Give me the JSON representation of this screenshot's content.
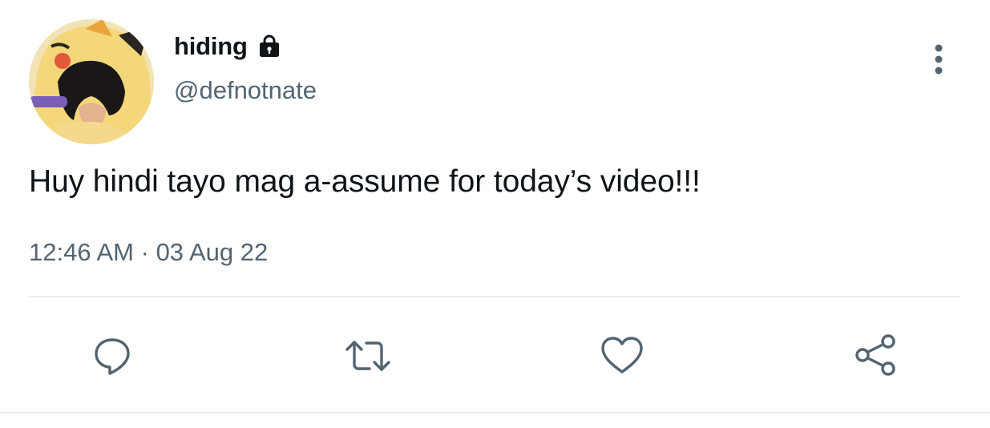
{
  "user": {
    "display_name": "hiding",
    "handle": "@defnotnate",
    "protected_icon": "lock-icon"
  },
  "tweet": {
    "text": "Huy hindi tayo mag a-assume for today’s video!!!",
    "time": "12:46 AM",
    "separator": "·",
    "date": "03 Aug 22"
  },
  "actions": [
    {
      "name": "reply",
      "icon": "reply-icon"
    },
    {
      "name": "retweet",
      "icon": "retweet-icon"
    },
    {
      "name": "like",
      "icon": "heart-icon"
    },
    {
      "name": "share",
      "icon": "share-icon"
    }
  ],
  "colors": {
    "text_primary": "#0f1419",
    "text_secondary": "#536471",
    "icon": "#536471",
    "divider": "#e7ebee"
  }
}
